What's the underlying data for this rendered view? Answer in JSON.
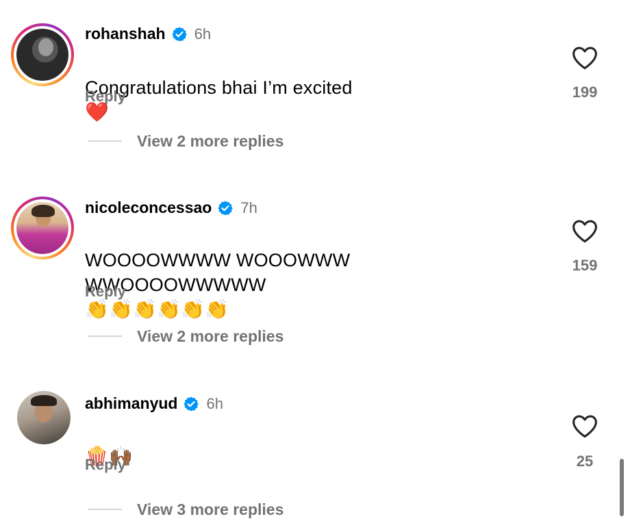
{
  "comments": [
    {
      "username": "rohanshah",
      "time": "6h",
      "text": "Congratulations bhai I’m excited",
      "emoji": "❤️",
      "reply_label": "Reply",
      "likes": "199",
      "view_replies": "View 2 more replies",
      "story_ring": true
    },
    {
      "username": "nicoleconcessao",
      "time": "7h",
      "text": "WOOOOWWWW WOOOWWW\nWWOOOOWWWWW",
      "emoji": "👏👏👏👏👏👏",
      "reply_label": "Reply",
      "likes": "159",
      "view_replies": "View 2 more replies",
      "story_ring": true
    },
    {
      "username": "abhimanyud",
      "time": "6h",
      "text": "",
      "emoji": "🍿🙌🏾",
      "reply_label": "Reply",
      "likes": "25",
      "view_replies": "View 3 more replies",
      "story_ring": false
    }
  ],
  "icons": {
    "like": "heart-outline-icon",
    "verified": "verified-badge-icon"
  },
  "colors": {
    "verified_blue": "#0095f6",
    "secondary_text": "#737373",
    "heart_red": "#e0245e"
  }
}
